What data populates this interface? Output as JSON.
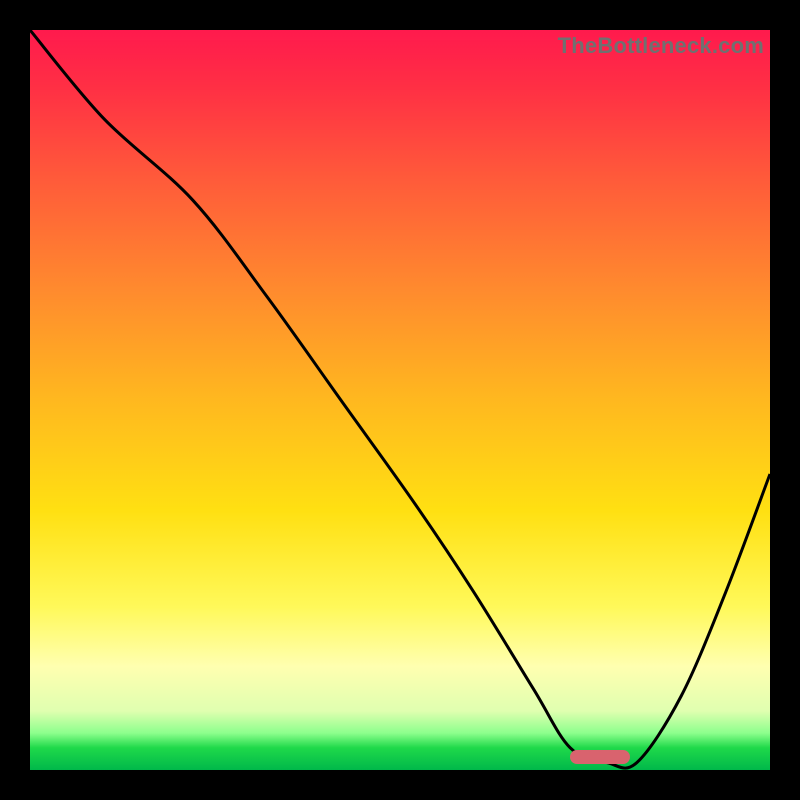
{
  "watermark": "TheBottleneck.com",
  "marker": {
    "x_pct": 77,
    "y_pct": 98.3,
    "color": "#d9636e"
  },
  "chart_data": {
    "type": "line",
    "title": "",
    "xlabel": "",
    "ylabel": "",
    "xlim": [
      0,
      100
    ],
    "ylim": [
      0,
      100
    ],
    "series": [
      {
        "name": "bottleneck-curve",
        "x": [
          0,
          10,
          22,
          32,
          42,
          52,
          60,
          68,
          73,
          78,
          82,
          88,
          94,
          100
        ],
        "y": [
          100,
          88,
          77,
          64,
          50,
          36,
          24,
          11,
          3,
          1,
          1,
          10,
          24,
          40
        ]
      }
    ],
    "background_gradient": {
      "stops": [
        {
          "pct": 0,
          "color": "#ff1a4d"
        },
        {
          "pct": 8,
          "color": "#ff3044"
        },
        {
          "pct": 20,
          "color": "#ff5a3a"
        },
        {
          "pct": 35,
          "color": "#ff8a2e"
        },
        {
          "pct": 50,
          "color": "#ffb81f"
        },
        {
          "pct": 65,
          "color": "#ffe012"
        },
        {
          "pct": 78,
          "color": "#fff95a"
        },
        {
          "pct": 86,
          "color": "#ffffb0"
        },
        {
          "pct": 92,
          "color": "#e0ffb0"
        },
        {
          "pct": 95,
          "color": "#8dff8d"
        },
        {
          "pct": 97,
          "color": "#1fd94a"
        },
        {
          "pct": 100,
          "color": "#00b84a"
        }
      ]
    }
  }
}
